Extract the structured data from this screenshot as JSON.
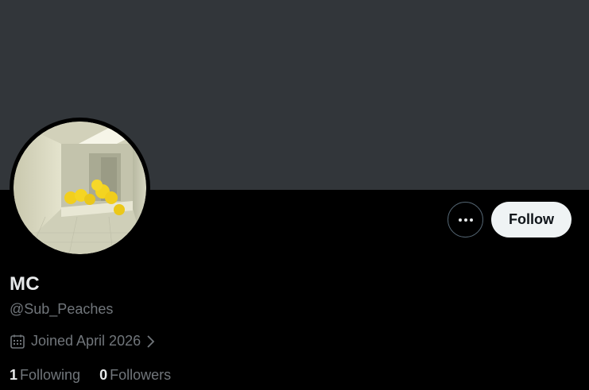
{
  "profile": {
    "display_name": "MC",
    "handle": "@Sub_Peaches",
    "joined_text": "Joined April 2026",
    "following_count": "1",
    "following_label": "Following",
    "followers_count": "0",
    "followers_label": "Followers"
  },
  "actions": {
    "follow_label": "Follow",
    "more_icon": "more-horizontal-icon"
  },
  "icons": {
    "calendar": "calendar-icon",
    "chevron": "chevron-right-icon"
  },
  "colors": {
    "banner": "#32363a",
    "background": "#000000",
    "primary_text": "#e7e9ea",
    "secondary_text": "#71767b",
    "follow_button_bg": "#eff3f4"
  }
}
